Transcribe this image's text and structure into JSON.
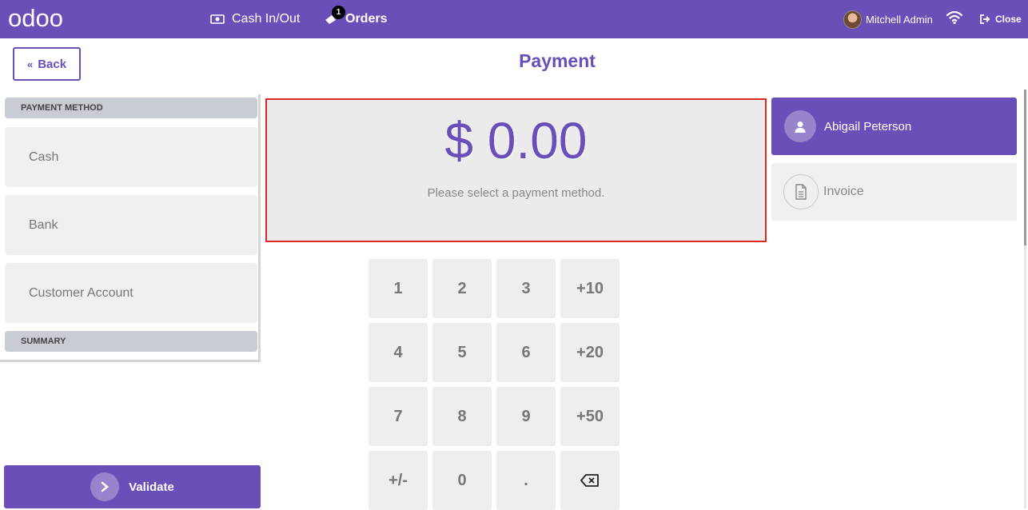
{
  "navbar": {
    "logo_text": "odoo",
    "cash_label": "Cash In/Out",
    "orders_label": "Orders",
    "orders_badge": "1",
    "user_name": "Mitchell Admin",
    "close_label": "Close"
  },
  "header": {
    "back_label": "Back",
    "title": "Payment"
  },
  "payment_methods": {
    "header": "PAYMENT METHOD",
    "items": [
      "Cash",
      "Bank",
      "Customer Account"
    ]
  },
  "summary": {
    "header": "SUMMARY"
  },
  "amount": {
    "value": "$ 0.00",
    "hint": "Please select a payment method."
  },
  "numpad": {
    "keys": [
      "1",
      "2",
      "3",
      "+10",
      "4",
      "5",
      "6",
      "+20",
      "7",
      "8",
      "9",
      "+50",
      "+/-",
      "0",
      "."
    ],
    "backspace_icon": "backspace-icon"
  },
  "customer": {
    "name": "Abigail Peterson"
  },
  "invoice": {
    "label": "Invoice"
  },
  "validate": {
    "label": "Validate"
  },
  "colors": {
    "primary": "#6b4fb8",
    "highlight_border": "#d9292b"
  }
}
